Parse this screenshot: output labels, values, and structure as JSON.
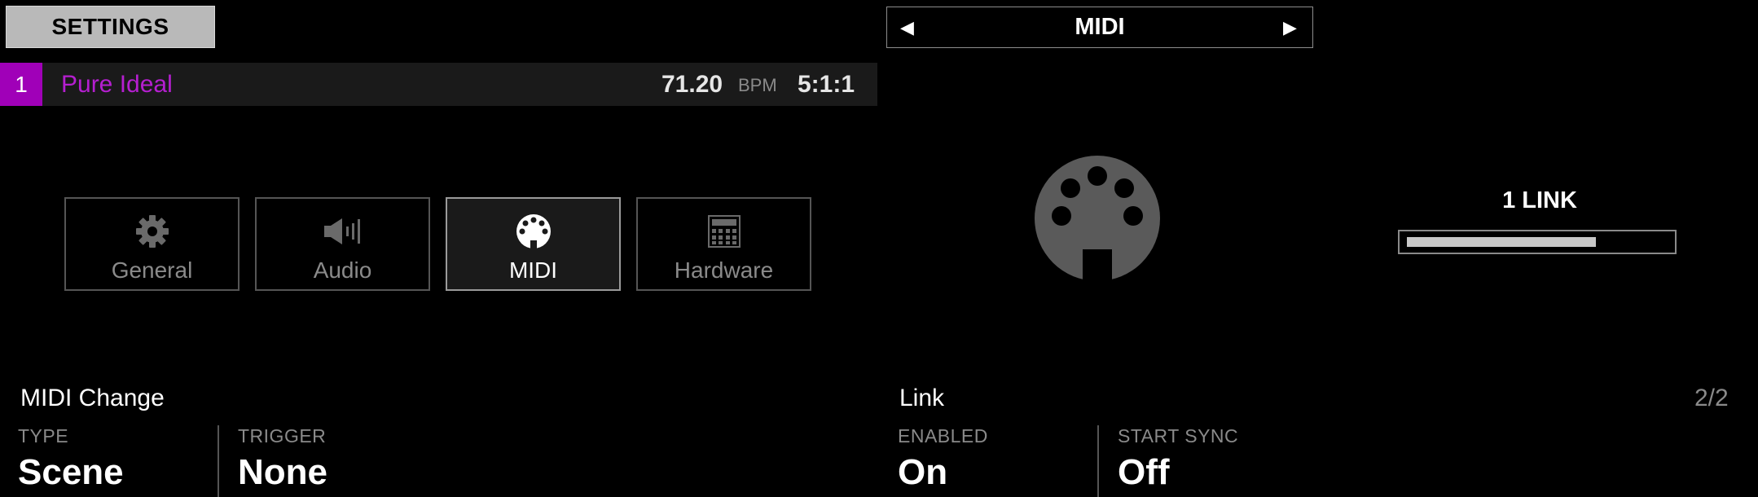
{
  "header": {
    "settings_label": "SETTINGS",
    "project": {
      "number": "1",
      "name": "Pure Ideal",
      "tempo": "71.20",
      "tempo_unit": "BPM",
      "position": "5:1:1"
    }
  },
  "page_selector": {
    "title": "MIDI",
    "prev_glyph": "◀",
    "next_glyph": "▶"
  },
  "tabs": [
    {
      "label": "General",
      "icon": "gear-icon",
      "active": false
    },
    {
      "label": "Audio",
      "icon": "speaker-icon",
      "active": false
    },
    {
      "label": "MIDI",
      "icon": "midi-connector-icon",
      "active": true
    },
    {
      "label": "Hardware",
      "icon": "hardware-icon",
      "active": false
    }
  ],
  "link_status": {
    "label": "1 LINK",
    "level_fraction": 0.72
  },
  "sections": {
    "midi_change": {
      "title": "MIDI Change",
      "params": [
        {
          "label": "TYPE",
          "value": "Scene"
        },
        {
          "label": "TRIGGER",
          "value": "None"
        }
      ]
    },
    "link": {
      "title": "Link",
      "params": [
        {
          "label": "ENABLED",
          "value": "On"
        },
        {
          "label": "START SYNC",
          "value": "Off"
        }
      ]
    }
  },
  "pager": "2/2",
  "colors": {
    "accent_purple": "#a000b8",
    "project_name": "#b51fd0",
    "icon_gray": "#5a5a5a"
  }
}
